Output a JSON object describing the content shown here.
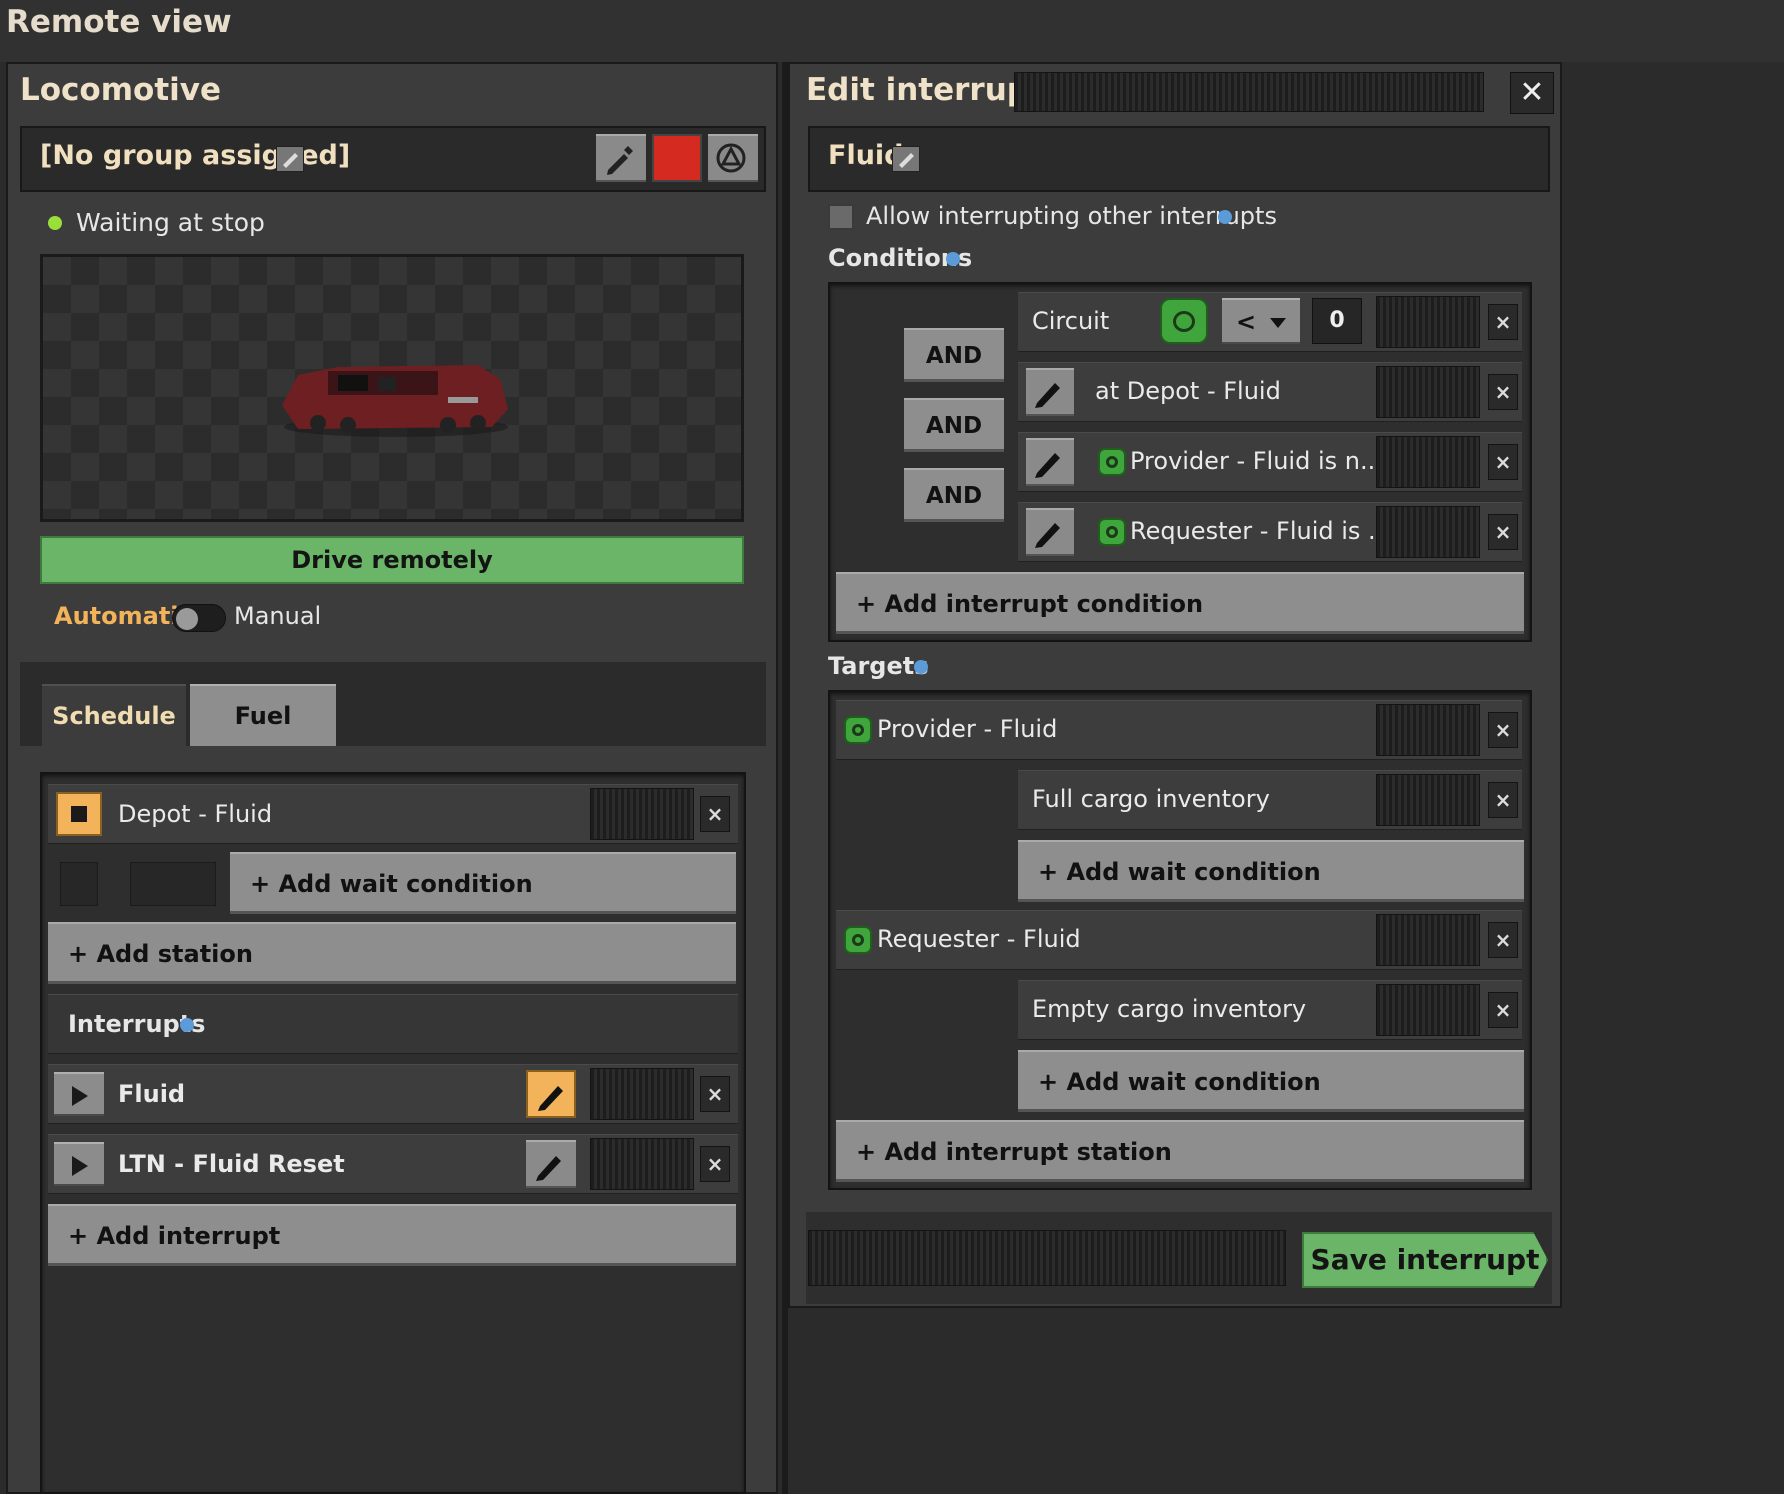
{
  "window": {
    "title": "Remote view"
  },
  "locomotive": {
    "title": "Locomotive",
    "group_label": "[No group assigned]",
    "status": "Waiting at stop",
    "drive_label": "Drive remotely",
    "mode_auto": "Automatic",
    "mode_manual": "Manual",
    "mode_value": "Automatic",
    "color_swatch": "#d42a1f"
  },
  "tabs": [
    {
      "label": "Schedule",
      "active": true
    },
    {
      "label": "Fuel",
      "active": false
    }
  ],
  "schedule": {
    "station": "Depot - Fluid",
    "add_wait": "+ Add wait condition",
    "add_station": "+ Add station",
    "interrupts_label": "Interrupts",
    "interrupts": [
      {
        "name": "Fluid",
        "editing": true
      },
      {
        "name": "LTN - Fluid Reset",
        "editing": false
      }
    ],
    "add_interrupt": "+ Add interrupt"
  },
  "edit_interrupt": {
    "title": "Edit interrupt",
    "name": "Fluid",
    "allow_label": "Allow interrupting other interrupts",
    "allow_checked": false,
    "conditions_label": "Conditions",
    "conditions": [
      {
        "text": "Circuit",
        "operator": "<",
        "value": "0"
      },
      {
        "joiner": "AND",
        "text": "at Depot - Fluid"
      },
      {
        "joiner": "AND",
        "text": "Provider - Fluid is n..."
      },
      {
        "joiner": "AND",
        "text": "Requester - Fluid is ..."
      }
    ],
    "add_condition": "+ Add interrupt condition",
    "targets_label": "Targets",
    "targets": [
      {
        "station": "Provider - Fluid",
        "wait": "Full cargo inventory",
        "add_wait": "+ Add wait condition"
      },
      {
        "station": "Requester - Fluid",
        "wait": "Empty cargo inventory",
        "add_wait": "+ Add wait condition"
      }
    ],
    "add_station": "+ Add interrupt station",
    "save_label": "Save interrupt"
  },
  "colors": {
    "accent_green": "#6ab567",
    "accent_orange": "#f3b35a",
    "status_dot": "#9ade3a"
  }
}
